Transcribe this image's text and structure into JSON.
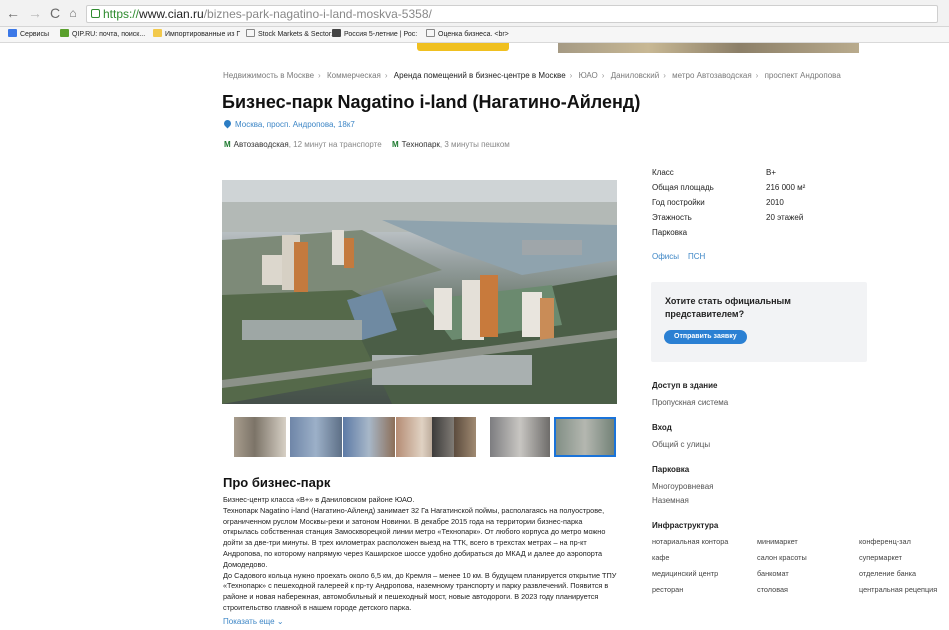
{
  "browser": {
    "url_scheme": "https://",
    "url_host": "www.cian.ru",
    "url_path": "/biznes-park-nagatino-i-land-moskva-5358/",
    "bookmarks": [
      "Сервисы",
      "QIP.RU: почта, поиск...",
      "Импортированные из Г",
      "Stock Markets & Sector:",
      "Россия 5-летние | Рос:",
      "Оценка бизнеса. <br>"
    ]
  },
  "breadcrumb": [
    "Недвижимость в Москве",
    "Коммерческая",
    "Аренда помещений в бизнес-центре в Москве",
    "ЮАО",
    "Даниловский",
    "метро Автозаводская",
    "проспект Андропова"
  ],
  "title": "Бизнес-парк Nagatino i-land (Нагатино-Айленд)",
  "address": "Москва, просп. Андропова, 18к7",
  "metro": [
    {
      "name": "Автозаводская",
      "note": "12 минут на транспорте"
    },
    {
      "name": "Технопарк",
      "note": "3 минуты пешком"
    }
  ],
  "specs": [
    {
      "label": "Класс",
      "value": "B+"
    },
    {
      "label": "Общая площадь",
      "value": "216 000 м²"
    },
    {
      "label": "Год постройки",
      "value": "2010"
    },
    {
      "label": "Этажность",
      "value": "20 этажей"
    },
    {
      "label": "Парковка",
      "value": ""
    }
  ],
  "tags": [
    "Офисы",
    "ПСН"
  ],
  "cta": {
    "text": "Хотите стать официальным представителем?",
    "button": "Отправить заявку"
  },
  "access": {
    "title": "Доступ в здание",
    "lines": [
      "Пропускная система"
    ]
  },
  "entrance": {
    "title": "Вход",
    "lines": [
      "Общий с улицы"
    ]
  },
  "parking": {
    "title": "Парковка",
    "lines": [
      "Многоуровневая",
      "Наземная"
    ]
  },
  "infra": {
    "title": "Инфраструктура",
    "items": [
      "нотариальная контора",
      "минимаркет",
      "конференц-зал",
      "кафе",
      "салон красоты",
      "супермаркет",
      "медицинский центр",
      "банкомат",
      "отделение банка",
      "ресторан",
      "столовая",
      "центральная рецепция"
    ]
  },
  "about": {
    "title": "Про бизнес-парк",
    "paragraphs": [
      "Бизнес-центр класса «B+» в Даниловском районе ЮАО.",
      "Технопарк Nagatino i-land (Нагатино-Айленд) занимает 32 Га Нагатинской поймы, располагаясь на полуострове, ограниченном руслом Москвы-реки и затоном Новинки. В декабре 2015 года на территории бизнес-парка открылась собственная станция Замоскворецкой линии метро «Технопарк». От любого корпуса до метро можно дойти за две-три минуты. В трех километрах расположен выезд на ТТК, всего в трехстах метрах – на пр-кт Андропова, по которому напрямую через Каширское шоссе удобно добираться до МКАД и далее до аэропорта Домодедово.",
      "До Садового кольца нужно проехать около 6,5 км, до Кремля – менее 10 км. В будущем планируется открытие ТПУ «Технопарк» с пешеходной галереей к пр-ту Андропова, наземному транспорту и парку развлечений. Появится в районе и новая набережная, автомобильный и пешеходный мост, новые автодороги. В 2023 году планируется строительство главной в нашем городе детского парка."
    ],
    "show_more": "Показать еще"
  }
}
